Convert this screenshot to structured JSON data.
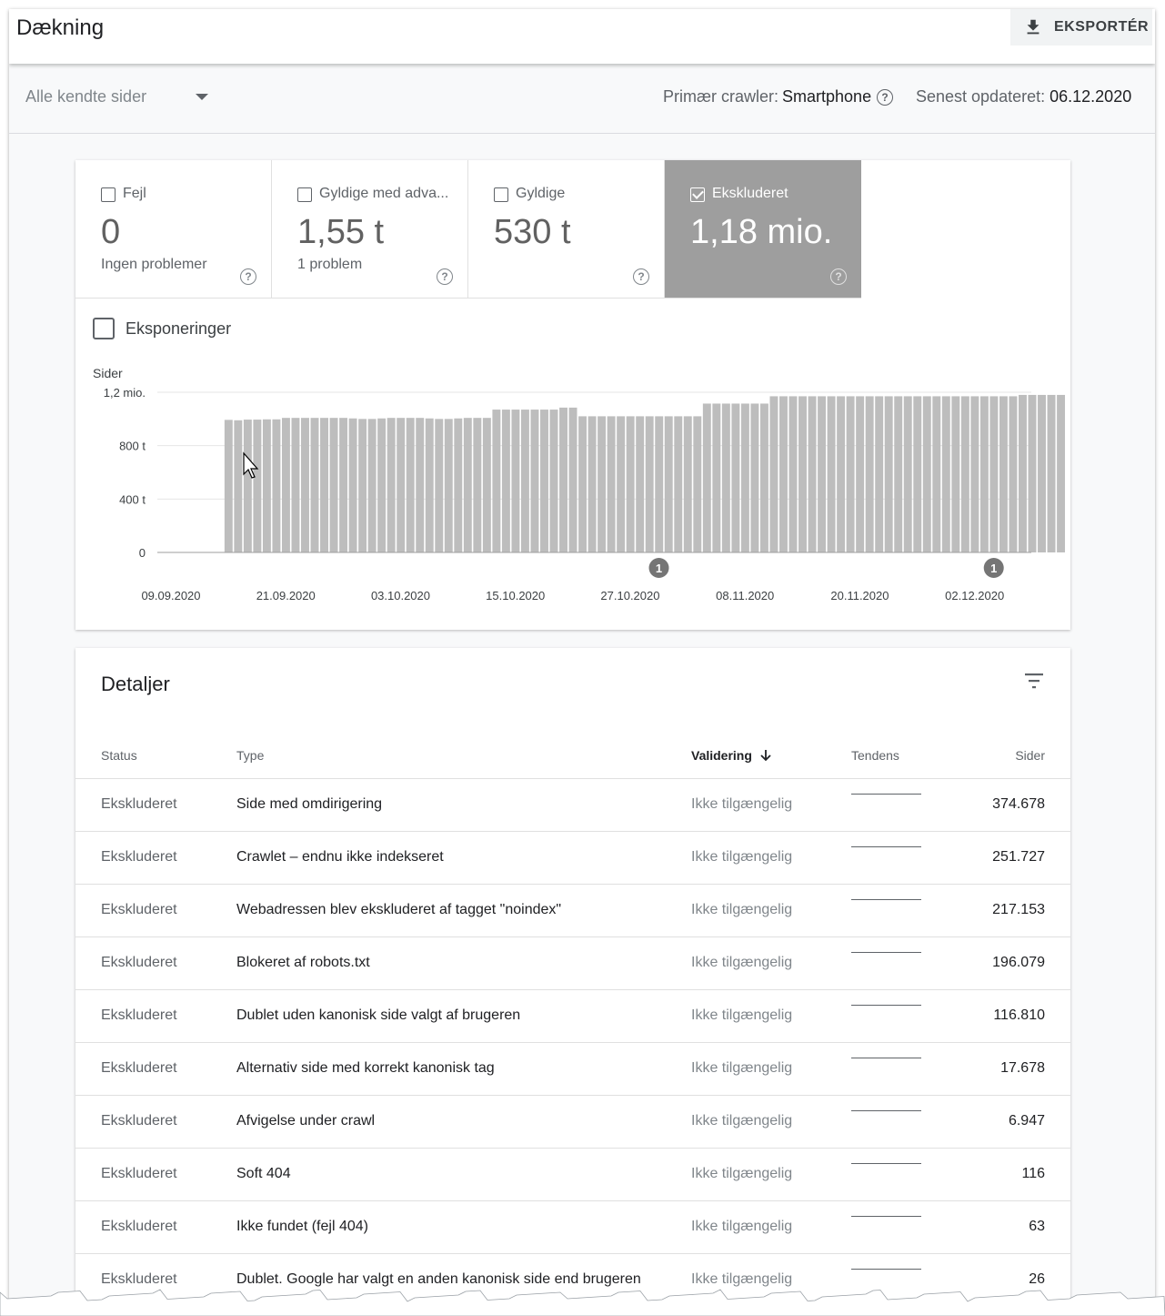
{
  "header": {
    "title": "Dækning",
    "export_label": "EKSPORTÉR"
  },
  "filters": {
    "pages_select": "Alle kendte sider",
    "crawler_label": "Primær crawler:",
    "crawler_value": "Smartphone",
    "updated_label": "Senest opdateret:",
    "updated_value": "06.12.2020"
  },
  "tiles": [
    {
      "label": "Fejl",
      "value": "0",
      "sub": "Ingen problemer",
      "checked": false
    },
    {
      "label": "Gyldige med adva...",
      "value": "1,55 t",
      "sub": "1 problem",
      "checked": false
    },
    {
      "label": "Gyldige",
      "value": "530 t",
      "sub": "",
      "checked": false
    },
    {
      "label": "Ekskluderet",
      "value": "1,18 mio.",
      "sub": "",
      "checked": true
    }
  ],
  "help_glyph": "?",
  "impressions_label": "Eksponeringer",
  "chart_data": {
    "type": "bar",
    "ylabel": "Sider",
    "yticks": [
      "0",
      "400 t",
      "800 t",
      "1,2 mio."
    ],
    "ytick_values": [
      0,
      400000,
      800000,
      1200000
    ],
    "ylim": [
      0,
      1200000
    ],
    "xticks": [
      "09.09.2020",
      "21.09.2020",
      "03.10.2020",
      "15.10.2020",
      "27.10.2020",
      "08.11.2020",
      "20.11.2020",
      "02.12.2020"
    ],
    "x_start_date": "09.09.2020",
    "x_end_date": "06.12.2020",
    "first_bar_date": "15.09.2020",
    "color": "#bdbdbd",
    "values": [
      993000,
      990000,
      995000,
      995000,
      997000,
      997000,
      1008000,
      1008000,
      1008000,
      1008000,
      1008000,
      1008000,
      1008000,
      1004000,
      1000000,
      1000000,
      1004000,
      1008000,
      1008000,
      1008000,
      1008000,
      1004000,
      1000000,
      1000000,
      1004000,
      1008000,
      1008000,
      1008000,
      1070000,
      1070000,
      1070000,
      1070000,
      1070000,
      1070000,
      1070000,
      1085000,
      1085000,
      1020000,
      1020000,
      1020000,
      1020000,
      1020000,
      1020000,
      1020000,
      1020000,
      1020000,
      1020000,
      1020000,
      1020000,
      1020000,
      1115000,
      1115000,
      1115000,
      1115000,
      1115000,
      1115000,
      1115000,
      1170000,
      1170000,
      1170000,
      1170000,
      1170000,
      1170000,
      1170000,
      1170000,
      1170000,
      1170000,
      1170000,
      1170000,
      1170000,
      1170000,
      1170000,
      1170000,
      1170000,
      1170000,
      1170000,
      1170000,
      1170000,
      1170000,
      1170000,
      1170000,
      1170000,
      1170000,
      1180000,
      1180000,
      1180000,
      1180000,
      1180000
    ],
    "annotations": [
      {
        "date": "30.10.2020",
        "label": "1"
      },
      {
        "date": "04.12.2020",
        "label": "1"
      }
    ]
  },
  "details": {
    "title": "Detaljer",
    "columns": {
      "status": "Status",
      "type": "Type",
      "validation": "Validering",
      "trend": "Tendens",
      "pages": "Sider"
    },
    "rows": [
      {
        "status": "Ekskluderet",
        "type": "Side med omdirigering",
        "validation": "Ikke tilgængelig",
        "pages": "374.678"
      },
      {
        "status": "Ekskluderet",
        "type": "Crawlet – endnu ikke indekseret",
        "validation": "Ikke tilgængelig",
        "pages": "251.727"
      },
      {
        "status": "Ekskluderet",
        "type": "Webadressen blev ekskluderet af tagget \"noindex\"",
        "validation": "Ikke tilgængelig",
        "pages": "217.153"
      },
      {
        "status": "Ekskluderet",
        "type": "Blokeret af robots.txt",
        "validation": "Ikke tilgængelig",
        "pages": "196.079"
      },
      {
        "status": "Ekskluderet",
        "type": "Dublet uden kanonisk side valgt af brugeren",
        "validation": "Ikke tilgængelig",
        "pages": "116.810"
      },
      {
        "status": "Ekskluderet",
        "type": "Alternativ side med korrekt kanonisk tag",
        "validation": "Ikke tilgængelig",
        "pages": "17.678"
      },
      {
        "status": "Ekskluderet",
        "type": "Afvigelse under crawl",
        "validation": "Ikke tilgængelig",
        "pages": "6.947"
      },
      {
        "status": "Ekskluderet",
        "type": "Soft 404",
        "validation": "Ikke tilgængelig",
        "pages": "116"
      },
      {
        "status": "Ekskluderet",
        "type": "Ikke fundet (fejl 404)",
        "validation": "Ikke tilgængelig",
        "pages": "63"
      },
      {
        "status": "Ekskluderet",
        "type": "Dublet. Google har valgt en anden kanonisk side end brugeren",
        "validation": "Ikke tilgængelig",
        "pages": "26"
      }
    ]
  },
  "colors": {
    "accent_tile": "#9e9e9e",
    "bar": "#bdbdbd",
    "annotation": "#757575"
  }
}
